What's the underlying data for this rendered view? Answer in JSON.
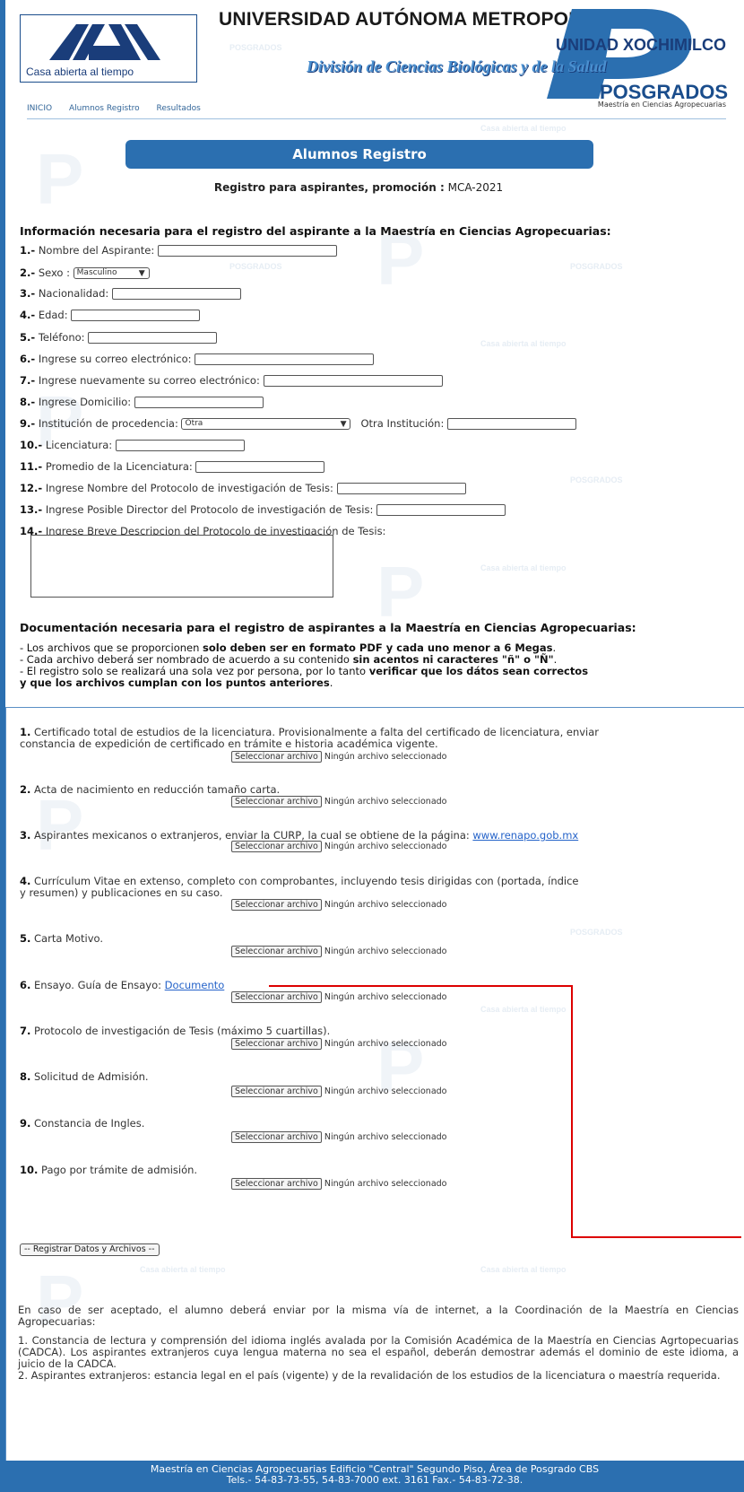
{
  "header": {
    "motto": "Casa abierta al tiempo",
    "university": "UNIVERSIDAD AUTÓNOMA METROPOLITANA",
    "unidad": "UNIDAD XOCHIMILCO",
    "division": "División de Ciencias Biológicas y de la Salud",
    "posgrados": "POSGRADOS",
    "program": "Maestría en Ciencias Agropecuarias"
  },
  "nav": {
    "items": [
      "INICIO",
      "Alumnos Registro",
      "Resultados"
    ]
  },
  "watermark": {
    "posgrados": "POSGRADOS",
    "motto": "Casa abierta al tiempo"
  },
  "page": {
    "title": "Alumnos Registro",
    "subtitle_label": "Registro para aspirantes, promoción :",
    "subtitle_value": "MCA-2021"
  },
  "form": {
    "heading": "Información necesaria para el registro del aspirante a la Maestría en Ciencias Agropecuarias:",
    "fields": [
      {
        "num": "1.-",
        "label": "Nombre del Aspirante:"
      },
      {
        "num": "2.-",
        "label": "Sexo :",
        "value": "Masculino"
      },
      {
        "num": "3.-",
        "label": "Nacionalidad:"
      },
      {
        "num": "4.-",
        "label": "Edad:"
      },
      {
        "num": "5.-",
        "label": "Teléfono:"
      },
      {
        "num": "6.-",
        "label": "Ingrese su correo electrónico:"
      },
      {
        "num": "7.-",
        "label": "Ingrese nuevamente su correo electrónico:"
      },
      {
        "num": "8.-",
        "label": "Ingrese Domicilio:"
      },
      {
        "num": "9.-",
        "label": "Institución de procedencia:",
        "value": "Otra",
        "extra_label": "Otra Institución:"
      },
      {
        "num": "10.-",
        "label": "Licenciatura:"
      },
      {
        "num": "11.-",
        "label": "Promedio de la Licenciatura:"
      },
      {
        "num": "12.-",
        "label": "Ingrese Nombre del Protocolo de investigación de Tesis:"
      },
      {
        "num": "13.-",
        "label": "Ingrese Posible Director del Protocolo de investigación de Tesis:"
      },
      {
        "num": "14.-",
        "label": "Ingrese Breve Descripcion del Protocolo de investigación de Tesis:"
      }
    ]
  },
  "docs": {
    "heading": "Documentación necesaria para el registro de aspirantes a la Maestría en Ciencias Agropecuarias:",
    "rule1_a": "- Los archivos que se proporcionen ",
    "rule1_b": "solo deben ser en formato PDF y cada uno menor a 6 Megas",
    "rule1_c": ".",
    "rule2_a": "- Cada archivo deberá ser nombrado de acuerdo a su contenido ",
    "rule2_b": "sin acentos ni caracteres \"ñ\" o \"Ñ\"",
    "rule2_c": ".",
    "rule3_a": "- El registro solo se realizará una sola vez por persona, por lo tanto ",
    "rule3_b": "verificar que los dátos sean correctos",
    "rule3_c": "y que los archivos cumplan con los puntos anteriores",
    "rule3_d": ".",
    "file_button": "Seleccionar archivo",
    "no_file": "Ningún archivo seleccionado",
    "items": [
      {
        "num": "1.",
        "text": "Certificado total de estudios de la licenciatura. Provisionalmente a falta del certificado de licenciatura, enviar",
        "text2": "constancia de expedición de certificado en trámite e historia académica vigente."
      },
      {
        "num": "2.",
        "text": "Acta de nacimiento en reducción tamaño carta."
      },
      {
        "num": "3.",
        "text": "Aspirantes mexicanos o extranjeros, enviar la CURP, la cual se obtiene de la página: ",
        "link": "www.renapo.gob.mx"
      },
      {
        "num": "4.",
        "text": "Currículum Vitae en extenso, completo con comprobantes, incluyendo tesis dirigidas con (portada, índice",
        "text2": "y resumen) y publicaciones en su caso."
      },
      {
        "num": "5.",
        "text": "Carta Motivo."
      },
      {
        "num": "6.",
        "text": "Ensayo. Guía de Ensayo: ",
        "link": "Documento"
      },
      {
        "num": "7.",
        "text": "Protocolo de investigación de Tesis (máximo 5 cuartillas)."
      },
      {
        "num": "8.",
        "text": "Solicitud de Admisión."
      },
      {
        "num": "9.",
        "text": "Constancia de Ingles."
      },
      {
        "num": "10.",
        "text": "Pago por trámite de admisión."
      }
    ],
    "submit": "-- Registrar Datos y Archivos --"
  },
  "final": {
    "p1": "En caso de ser aceptado, el alumno deberá enviar por la misma vía de internet, a la Coordinación de la Maestría en Ciencias Agropecuarias:",
    "p2": "1. Constancia de lectura y comprensión del idioma inglés avalada por la Comisión Académica de la Maestría en Ciencias Agrtopecuarias (CADCA). Los aspirantes extranjeros cuya lengua materna no sea el español, deberán demostrar además el dominio de este idioma, a juicio de la CADCA.",
    "p3": "2. Aspirantes extranjeros: estancia legal en el país (vigente) y de la revalidación de los estudios de la licenciatura o maestría requerida."
  },
  "footer": {
    "line1": "Maestría en Ciencias Agropecuarias Edificio \"Central\" Segundo Piso, Área de Posgrado CBS",
    "line2": "Tels.- 54-83-73-55, 54-83-7000 ext. 3161 Fax.- 54-83-72-38."
  },
  "colors": {
    "primary": "#2b6fb0",
    "link": "#2563c9",
    "annotation": "#dd0000"
  }
}
